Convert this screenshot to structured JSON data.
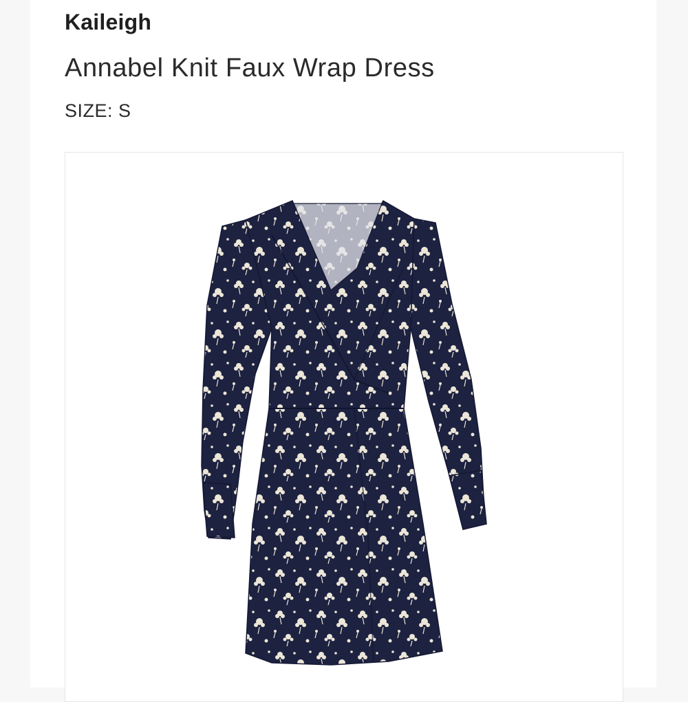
{
  "product": {
    "brand": "Kaileigh",
    "name": "Annabel Knit Faux Wrap Dress",
    "size_label": "SIZE:",
    "size_value": "S",
    "image_icon": "dress-photo",
    "colors": {
      "dress": "#1d2240",
      "print": "#ece6d8"
    }
  }
}
